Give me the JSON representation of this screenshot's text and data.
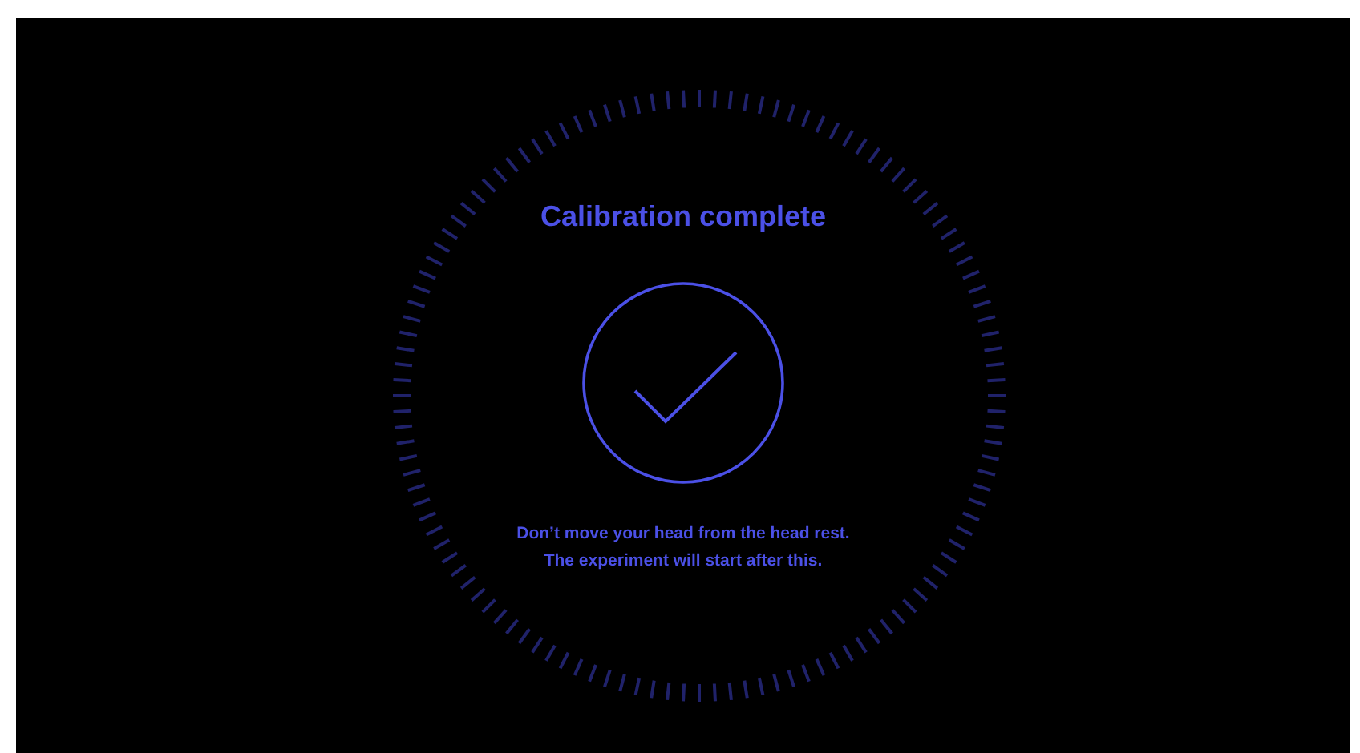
{
  "title": "Calibration complete",
  "message_lines": [
    "Don’t move your head from the head rest.",
    "The experiment will start after this."
  ]
}
